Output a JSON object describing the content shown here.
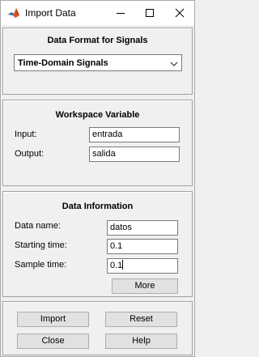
{
  "window": {
    "title": "Import Data"
  },
  "format_panel": {
    "title": "Data Format for Signals",
    "selected_format": "Time-Domain Signals"
  },
  "workspace_panel": {
    "title": "Workspace Variable",
    "input_label": "Input:",
    "input_value": "entrada",
    "output_label": "Output:",
    "output_value": "salida"
  },
  "info_panel": {
    "title": "Data Information",
    "data_name_label": "Data name:",
    "data_name_value": "datos",
    "start_label": "Starting time:",
    "start_value": "0.1",
    "sample_label": "Sample time:",
    "sample_value": "0.1",
    "more_label": "More"
  },
  "actions": {
    "import_label": "Import",
    "reset_label": "Reset",
    "close_label": "Close",
    "help_label": "Help"
  }
}
